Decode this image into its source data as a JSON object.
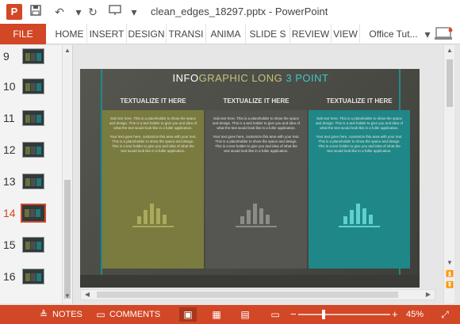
{
  "titlebar": {
    "app_icon": "P",
    "title": "clean_edges_18297.pptx - PowerPoint",
    "quick_access_icons": [
      "save-icon",
      "undo-icon",
      "redo-icon",
      "slideshow-icon",
      "customize-icon"
    ]
  },
  "ribbon": {
    "file_label": "FILE",
    "tabs": [
      "HOME",
      "INSERT",
      "DESIGN",
      "TRANSI",
      "ANIMA",
      "SLIDE S",
      "REVIEW",
      "VIEW",
      "Office Tut..."
    ]
  },
  "thumbnails": {
    "numbers": [
      "9",
      "10",
      "11",
      "12",
      "13",
      "14",
      "15",
      "16"
    ],
    "active": "14"
  },
  "slide": {
    "title_part1": "INFO",
    "title_part2": "GRAPHIC LONG ",
    "title_part3": "3 POINT",
    "columns": [
      {
        "heading": "TEXTUALIZE IT HERE",
        "para1": "Sub text here. This is a placeholder to show the space and design. This is a text holder to give you and idea of what the text would look like in a fuller application.",
        "para2": "Your text goes here, customize this area with your text. This is a placeholder to show the space and design. This is a text holder to give you and idea of what the text would look like in a fuller application."
      },
      {
        "heading": "TEXTUALIZE IT HERE",
        "para1": "Sub text here. This is a placeholder to show the space and design. This is a text holder to give you and idea of what the text would look like in a fuller application.",
        "para2": "Your text goes here, customize this area with your text. This is a placeholder to show the space and design. This is a text holder to give you and idea of what the text would look like in a fuller application."
      },
      {
        "heading": "TEXTUALIZE IT HERE",
        "para1": "Sub text here. This is a placeholder to show the space and design. This is a text holder to give you and idea of what the text would look like in a fuller application.",
        "para2": "Your text goes here, customize this area with your text. This is a placeholder to show the space and design. This is a text holder to give you and idea of what the text would look like in a fuller application."
      }
    ],
    "colors": {
      "col1_fill": "#7a7b3e",
      "col2_fill": "#555651",
      "col3_fill": "#1f8787",
      "col1_bars": "#a9aa5e",
      "col2_bars": "#8c8c86",
      "col3_bars": "#5fd0d0"
    }
  },
  "statusbar": {
    "notes_label": "NOTES",
    "comments_label": "COMMENTS",
    "zoom_out": "−",
    "zoom_in": "+",
    "zoom_level": "45%"
  }
}
